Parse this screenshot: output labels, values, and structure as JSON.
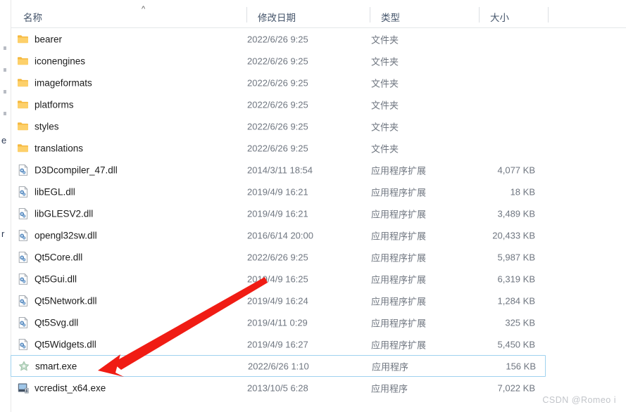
{
  "columns": {
    "name": "名称",
    "date_modified": "修改日期",
    "type": "类型",
    "size": "大小",
    "sort_caret": "^"
  },
  "left_strip_fragments": [
    "e",
    "r"
  ],
  "rows": [
    {
      "icon": "folder-icon",
      "name": "bearer",
      "date": "2022/6/26 9:25",
      "type": "文件夹",
      "size": ""
    },
    {
      "icon": "folder-icon",
      "name": "iconengines",
      "date": "2022/6/26 9:25",
      "type": "文件夹",
      "size": ""
    },
    {
      "icon": "folder-icon",
      "name": "imageformats",
      "date": "2022/6/26 9:25",
      "type": "文件夹",
      "size": ""
    },
    {
      "icon": "folder-icon",
      "name": "platforms",
      "date": "2022/6/26 9:25",
      "type": "文件夹",
      "size": ""
    },
    {
      "icon": "folder-icon",
      "name": "styles",
      "date": "2022/6/26 9:25",
      "type": "文件夹",
      "size": ""
    },
    {
      "icon": "folder-icon",
      "name": "translations",
      "date": "2022/6/26 9:25",
      "type": "文件夹",
      "size": ""
    },
    {
      "icon": "dll-icon",
      "name": "D3Dcompiler_47.dll",
      "date": "2014/3/11 18:54",
      "type": "应用程序扩展",
      "size": "4,077 KB"
    },
    {
      "icon": "dll-icon",
      "name": "libEGL.dll",
      "date": "2019/4/9 16:21",
      "type": "应用程序扩展",
      "size": "18 KB"
    },
    {
      "icon": "dll-icon",
      "name": "libGLESV2.dll",
      "date": "2019/4/9 16:21",
      "type": "应用程序扩展",
      "size": "3,489 KB"
    },
    {
      "icon": "dll-icon",
      "name": "opengl32sw.dll",
      "date": "2016/6/14 20:00",
      "type": "应用程序扩展",
      "size": "20,433 KB"
    },
    {
      "icon": "dll-icon",
      "name": "Qt5Core.dll",
      "date": "2022/6/26 9:25",
      "type": "应用程序扩展",
      "size": "5,987 KB"
    },
    {
      "icon": "dll-icon",
      "name": "Qt5Gui.dll",
      "date": "2019/4/9 16:25",
      "type": "应用程序扩展",
      "size": "6,319 KB"
    },
    {
      "icon": "dll-icon",
      "name": "Qt5Network.dll",
      "date": "2019/4/9 16:24",
      "type": "应用程序扩展",
      "size": "1,284 KB"
    },
    {
      "icon": "dll-icon",
      "name": "Qt5Svg.dll",
      "date": "2019/4/11 0:29",
      "type": "应用程序扩展",
      "size": "325 KB"
    },
    {
      "icon": "dll-icon",
      "name": "Qt5Widgets.dll",
      "date": "2019/4/9 16:27",
      "type": "应用程序扩展",
      "size": "5,450 KB"
    },
    {
      "icon": "exe-icon",
      "name": "smart.exe",
      "date": "2022/6/26 1:10",
      "type": "应用程序",
      "size": "156 KB",
      "selected": true
    },
    {
      "icon": "installer-icon",
      "name": "vcredist_x64.exe",
      "date": "2013/10/5 6:28",
      "type": "应用程序",
      "size": "7,022 KB"
    }
  ],
  "annotation": {
    "arrow_color": "#f01c14",
    "arrow_target": "smart.exe"
  },
  "watermark": "CSDN @Romeo i",
  "colors": {
    "selection_border": "#9fd2ef",
    "header_text": "#44546a",
    "row_text": "#1c1c1c",
    "meta_text": "#6f7680",
    "folder": "#fcc85a",
    "arrow": "#f01c14"
  }
}
